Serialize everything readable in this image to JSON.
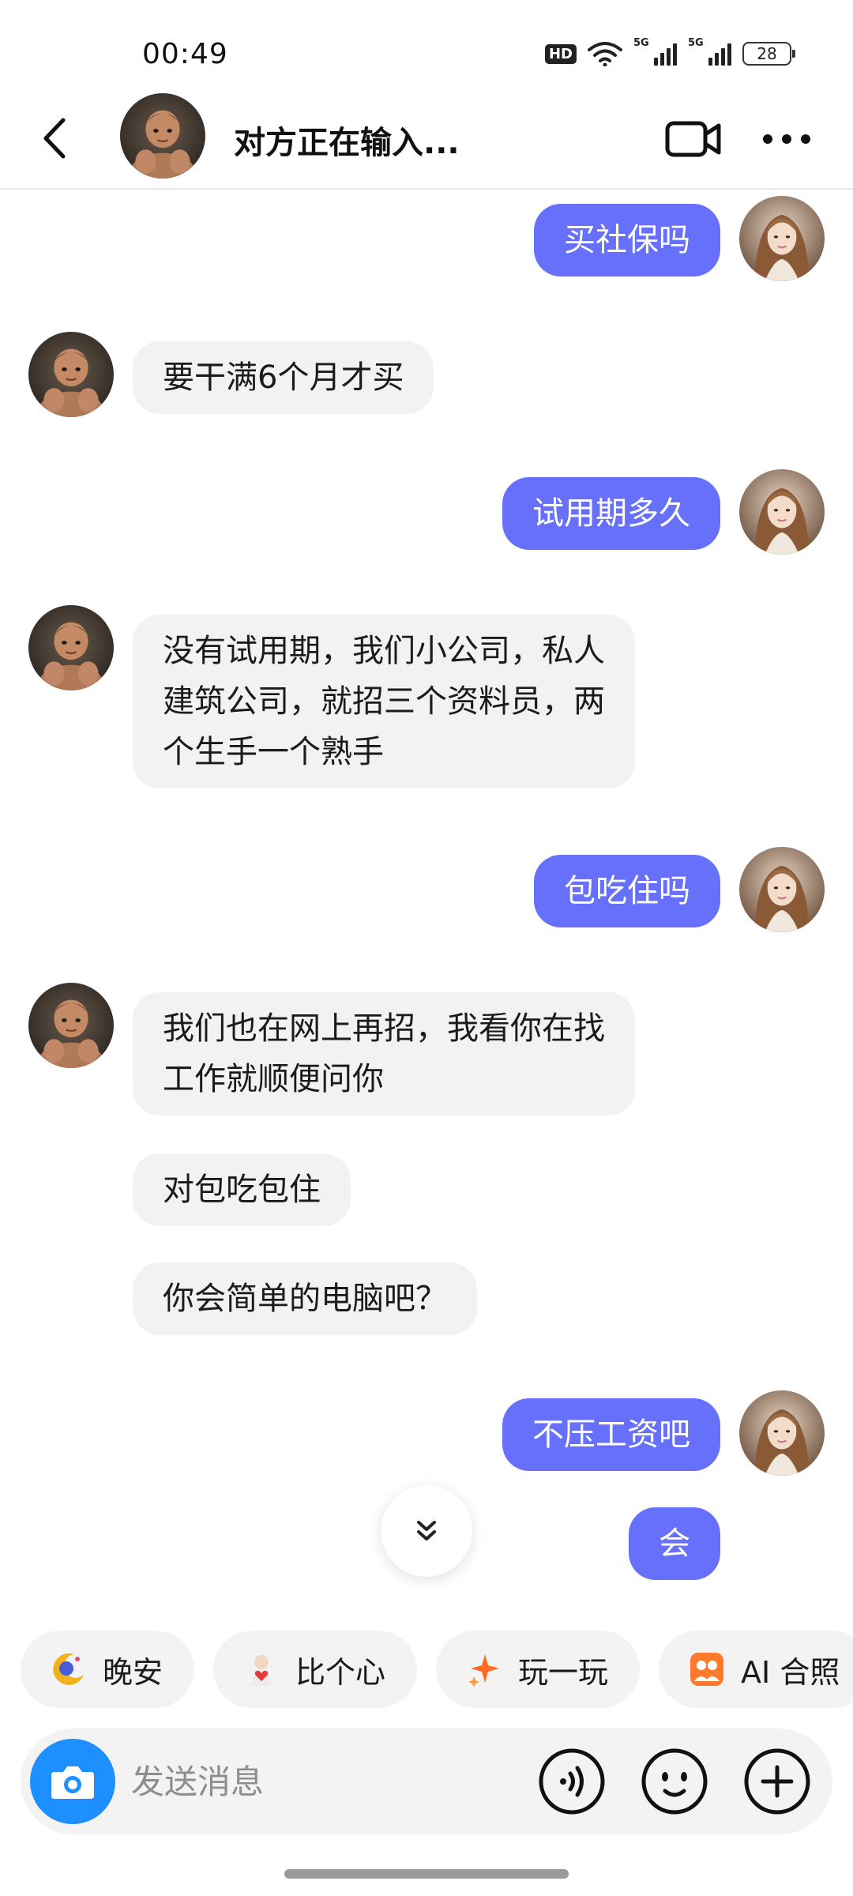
{
  "status_bar": {
    "time": "00:49",
    "hd_label": "HD",
    "network_1": "5G",
    "network_2": "5G",
    "battery": "28"
  },
  "header": {
    "title": "对方正在输入...",
    "back_icon": "chevron-left-icon",
    "video_icon": "video-camera-icon",
    "more_icon": "more-horizontal-icon"
  },
  "messages": [
    {
      "from": "me",
      "text": "买社保吗"
    },
    {
      "from": "other",
      "text": "要干满6个月才买"
    },
    {
      "from": "me",
      "text": "试用期多久"
    },
    {
      "from": "other",
      "lines": [
        "没有试用期，我们小公司，私人",
        "建筑公司，就招三个资料员，两",
        "个生手一个熟手"
      ]
    },
    {
      "from": "me",
      "text": "包吃住吗"
    },
    {
      "from": "other",
      "lines": [
        "我们也在网上再招，我看你在找",
        "工作就顺便问你"
      ]
    },
    {
      "from": "other",
      "text": "对包吃包住"
    },
    {
      "from": "other",
      "text": "你会简单的电脑吧？"
    },
    {
      "from": "me",
      "text": "不压工资吧"
    },
    {
      "from": "me",
      "text": "会"
    }
  ],
  "quick_actions": [
    {
      "label": "晚安",
      "icon": "moon-icon"
    },
    {
      "label": "比个心",
      "icon": "heart-gesture-icon"
    },
    {
      "label": "玩一玩",
      "icon": "sparkle-icon"
    },
    {
      "label": "AI 合照",
      "icon": "group-photo-icon"
    }
  ],
  "input": {
    "placeholder": "发送消息",
    "value": ""
  },
  "colors": {
    "outgoing_bubble": "#6770fa",
    "incoming_bubble": "#f2f2f2",
    "camera_button": "#1e8fff"
  }
}
